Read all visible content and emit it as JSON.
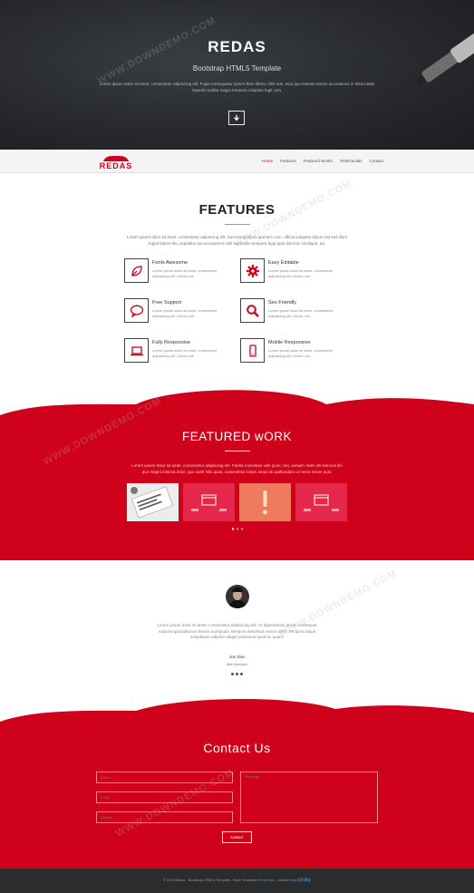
{
  "hero": {
    "title": "REDAS",
    "subtitle": "Bootstrap HTML5 Template",
    "text": "Lorem ipsum dolor sit amet, consectetur adipiscing elit. Fuga consequatur ipsum illum libero, nihil rem, eius quo eveniet earum accusamus in bland alias impedit mollitia magni tempora voluptas fugit cum.",
    "button_icon": "arrow-down-icon"
  },
  "nav": {
    "logo": "REDAS",
    "items": [
      "Home",
      "Features",
      "Featured Works",
      "Testimonials",
      "Contact"
    ],
    "active": "Home"
  },
  "features": {
    "title": "FEATURES",
    "text": "Lorem ipsum dolor sit amet, consectetur adipiscing elit. Sunt temporibus aperiam cum, officia voluptas dolore est sed illum fugiat labore illo, expedita nisi accusamus nihil explicabo tempore fuga quia dolorum similique, ad.",
    "items": [
      {
        "title": "Fonts Awesome",
        "desc": "Lorem ipsum dolor sit amet, consectetur adipisicing elit. Libero non",
        "icon": "leaf-icon"
      },
      {
        "title": "Easy Editable",
        "desc": "Lorem ipsum dolor sit amet, consectetur adipisicing elit. Libero non",
        "icon": "gear-icon"
      },
      {
        "title": "Free Support",
        "desc": "Lorem ipsum dolor sit amet, consectetur adipisicing elit. Libero non",
        "icon": "chat-icon"
      },
      {
        "title": "Seo Friendly",
        "desc": "Lorem ipsum dolor sit amet, consectetur adipisicing elit. Libero non",
        "icon": "search-icon"
      },
      {
        "title": "Fully Responsive",
        "desc": "Lorem ipsum dolor sit amet, consectetur adipisicing elit. Libero non",
        "icon": "laptop-icon"
      },
      {
        "title": "Mobile Responsive",
        "desc": "Lorem ipsum dolor sit amet, consectetur adipisicing elit. Libero non",
        "icon": "mobile-icon"
      }
    ]
  },
  "featured_work": {
    "title": "FEATURED wORK",
    "text": "Lorem ipsum dolor sit amet, consectetur adipiscing elit. Facilis molestiae velit quos, nisi, veniam. Nam ab sed eos illo quo magni minima dolor, quo sunt! Nisi quos, consectetur totam sequi ab quibusdam ut nemo rerum quis.",
    "thumbs": [
      "work-1",
      "work-2",
      "work-3",
      "work-4"
    ]
  },
  "testimonial": {
    "quote": "Lorem ipsum dolor sit amet, consectetur adipisicing elit. Ut dignissimos ipsum consequat corporis ipsa laborum facere numquam, tempore doloribus earum nihil? Tempora atque voluptatum adipisci eaque possimus quod ex quam.",
    "name": "Jon Doe",
    "role": "Web developer"
  },
  "contact": {
    "title": "Contact Us",
    "name_placeholder": "Name",
    "email_placeholder": "Email",
    "subject_placeholder": "Subject",
    "message_placeholder": "Message",
    "submit": "SUBMIT"
  },
  "footer": {
    "prefix": "© 2015 Redas - Bootstrap HTML5 Template - More Templates",
    "link1": "Ferry Bear",
    "middle": " - Collect from",
    "link2": "网页模板"
  },
  "colors": {
    "accent": "#d0021b",
    "dark": "#2b2c2e"
  }
}
